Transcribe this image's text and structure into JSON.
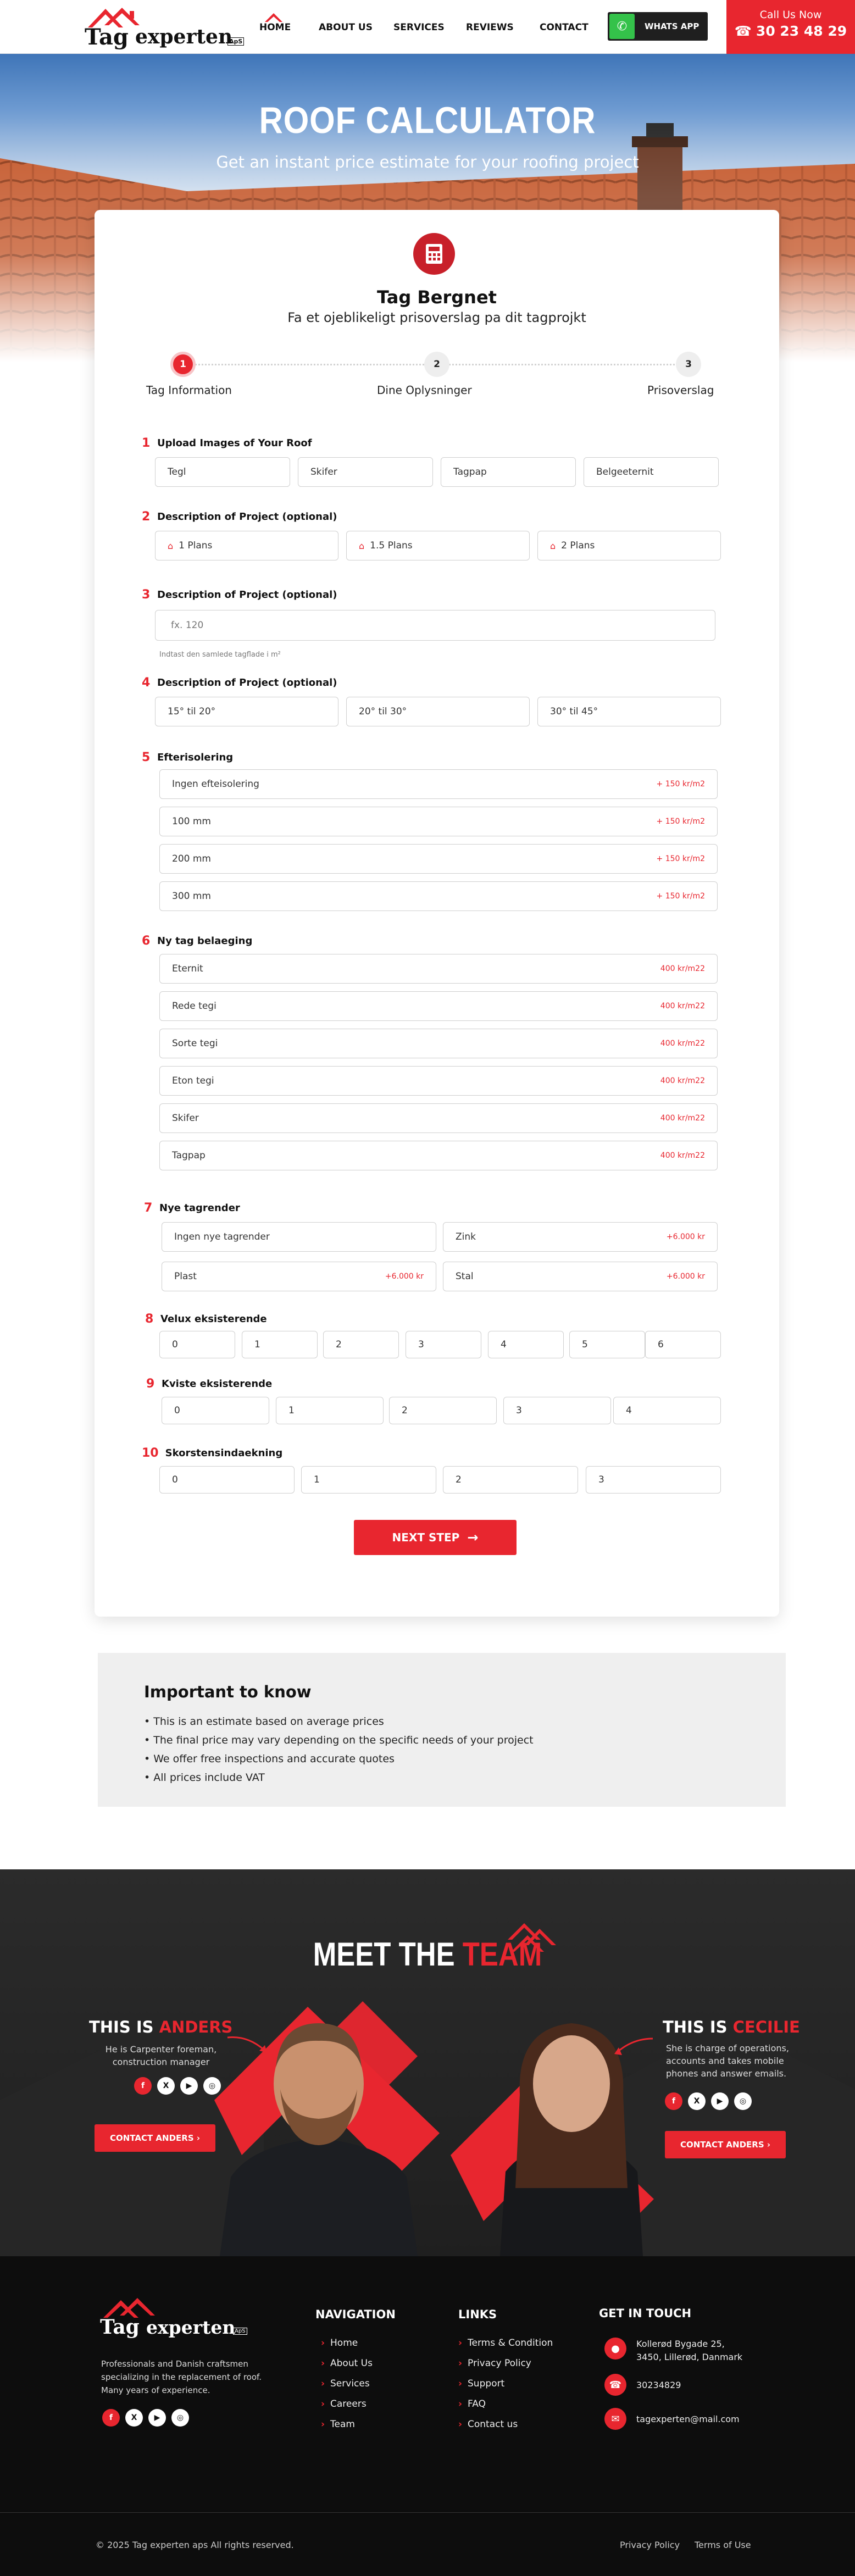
{
  "header": {
    "logo_part1": "Tag",
    "logo_part2": "experten",
    "logo_suffix": "ApS",
    "nav": [
      "HOME",
      "ABOUT US",
      "SERVICES",
      "REVIEWS",
      "CONTACT"
    ],
    "whatsapp_label": "WHATS APP",
    "call_label": "Call Us Now",
    "phone": "30 23 48 29"
  },
  "hero": {
    "title": "ROOF CALCULATOR",
    "subtitle": "Get an instant price estimate for your roofing project"
  },
  "calculator": {
    "title": "Tag Bergnet",
    "subtitle": "Fa et ojeblikeligt prisoverslag pa dit tagprojkt",
    "steps": [
      {
        "num": "1",
        "label": "Tag Information"
      },
      {
        "num": "2",
        "label": "Dine Oplysninger"
      },
      {
        "num": "3",
        "label": "Prisoverslag"
      }
    ],
    "sections": {
      "s1": {
        "num": "1",
        "label": "Upload Images of Your Roof",
        "options": [
          "Tegl",
          "Skifer",
          "Tagpap",
          "Belgeeternit"
        ]
      },
      "s2": {
        "num": "2",
        "label": "Description of Project (optional)",
        "options": [
          "1 Plans",
          "1.5 Plans",
          "2 Plans"
        ]
      },
      "s3": {
        "num": "3",
        "label": "Description of Project (optional)",
        "placeholder": "fx. 120",
        "hint": "Indtast den samlede tagflade i m²"
      },
      "s4": {
        "num": "4",
        "label": "Description of Project (optional)",
        "options": [
          "15° til 20°",
          "20° til 30°",
          "30° til 45°"
        ]
      },
      "s5": {
        "num": "5",
        "label": "Efterisolering",
        "options": [
          {
            "label": "Ingen efteisolering",
            "price": "+ 150 kr/m2"
          },
          {
            "label": "100 mm",
            "price": "+ 150 kr/m2"
          },
          {
            "label": "200 mm",
            "price": "+ 150 kr/m2"
          },
          {
            "label": "300 mm",
            "price": "+ 150 kr/m2"
          }
        ]
      },
      "s6": {
        "num": "6",
        "label": "Ny tag belaeging",
        "options": [
          {
            "label": "Eternit",
            "price": "400 kr/m22"
          },
          {
            "label": "Rede tegi",
            "price": "400 kr/m22"
          },
          {
            "label": "Sorte tegi",
            "price": "400 kr/m22"
          },
          {
            "label": "Eton tegi",
            "price": "400 kr/m22"
          },
          {
            "label": "Skifer",
            "price": "400 kr/m22"
          },
          {
            "label": "Tagpap",
            "price": "400 kr/m22"
          }
        ]
      },
      "s7": {
        "num": "7",
        "label": "Nye tagrender",
        "options": [
          {
            "label": "Ingen nye tagrender",
            "price": ""
          },
          {
            "label": "Zink",
            "price": "+6.000 kr"
          },
          {
            "label": "Plast",
            "price": "+6.000 kr"
          },
          {
            "label": "Stal",
            "price": "+6.000 kr"
          }
        ]
      },
      "s8": {
        "num": "8",
        "label": "Velux eksisterende",
        "options": [
          "0",
          "1",
          "2",
          "3",
          "4",
          "5",
          "6"
        ]
      },
      "s9": {
        "num": "9",
        "label": "Kviste eksisterende",
        "options": [
          "0",
          "1",
          "2",
          "3",
          "4"
        ]
      },
      "s10": {
        "num": "10",
        "label": "Skorstensindaekning",
        "options": [
          "0",
          "1",
          "2",
          "3"
        ]
      }
    },
    "next_label": "NEXT STEP"
  },
  "important": {
    "title": "Important to know",
    "items": [
      "• This is an estimate based on average prices",
      "• The final price may vary depending on the specific needs of your project",
      "• We offer free inspections and accurate quotes",
      "• All prices include VAT"
    ]
  },
  "team": {
    "title_white": "MEET THE",
    "title_red": "TEAM",
    "left": {
      "prefix": "THIS IS",
      "name": "ANDERS",
      "desc": "He is Carpenter foreman, construction manager",
      "button": "CONTACT ANDERS ›"
    },
    "right": {
      "prefix": "THIS IS",
      "name": "CECILIE",
      "desc": "She is charge of operations, accounts and takes mobile phones and answer emails.",
      "button": "CONTACT ANDERS ›"
    }
  },
  "footer": {
    "about": "Professionals and Danish craftsmen specializing in the replacement of roof. Many years of experience.",
    "nav_title": "NAVIGATION",
    "nav": [
      "Home",
      "About Us",
      "Services",
      "Careers",
      "Team"
    ],
    "links_title": "LINKS",
    "links": [
      "Terms & Condition",
      "Privacy Policy",
      "Support",
      "FAQ",
      "Contact us"
    ],
    "contact_title": "GET IN TOUCH",
    "address": "Kollerød Bygade 25, 3450, Lillerød, Danmark",
    "phone": "30234829",
    "email": "tagexperten@mail.com",
    "copyright": "© 2025 Tag experten aps All rights reserved.",
    "bottom_links": [
      "Privacy Policy",
      "Terms of Use"
    ]
  },
  "colors": {
    "accent": "#e8262f",
    "dark": "#1f1f1f",
    "footer": "#0d0d0d"
  }
}
